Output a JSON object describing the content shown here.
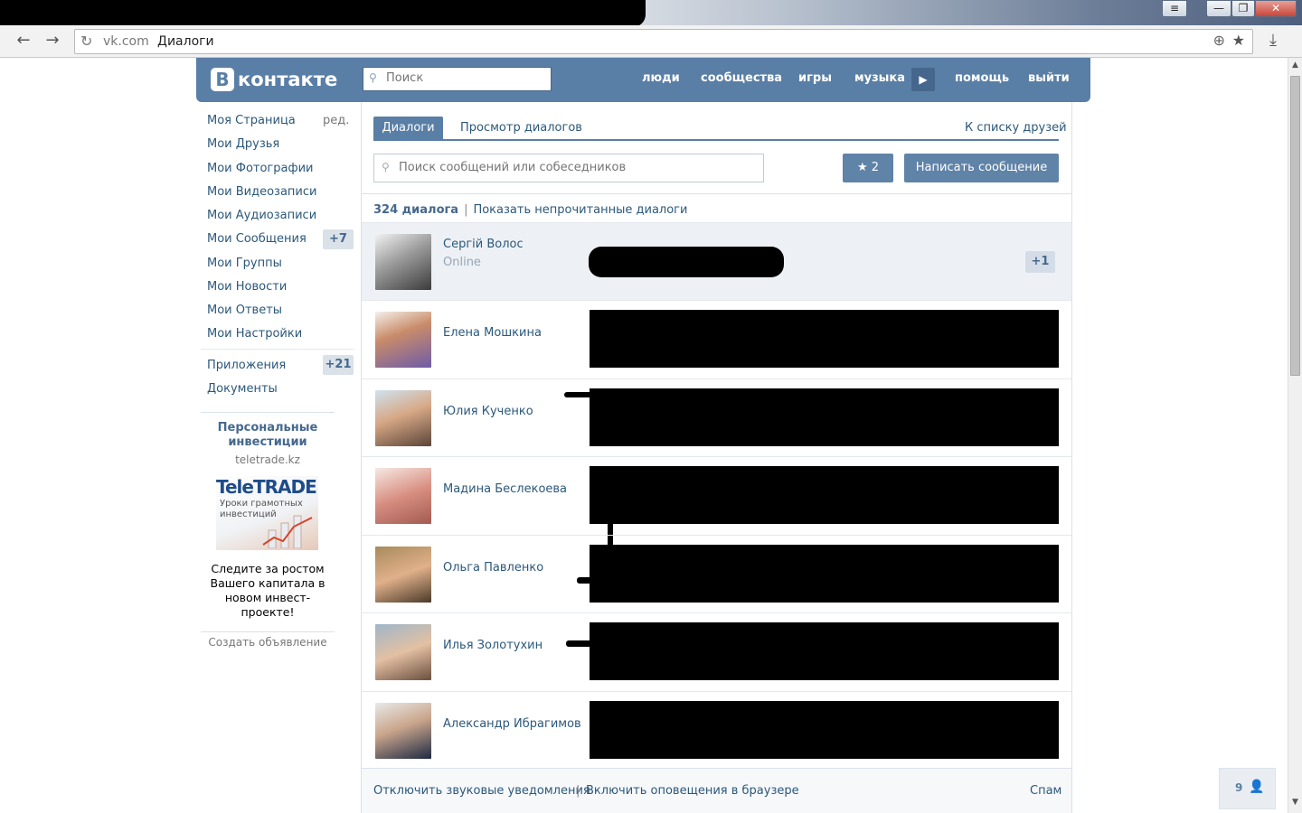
{
  "browser": {
    "url_host": "vk.com",
    "url_path": "Диалоги",
    "back_glyph": "←",
    "forward_glyph": "→",
    "reload_glyph": "↻",
    "zoom_glyph": "⊕",
    "star_glyph": "★",
    "download_glyph": "⤓",
    "window_buttons": [
      "≡",
      "—",
      "❐",
      "✕"
    ]
  },
  "header": {
    "logo_letter": "В",
    "logo_text": "контакте",
    "search_placeholder": "Поиск",
    "nav": [
      "люди",
      "сообщества",
      "игры",
      "музыка",
      "помощь",
      "выйти"
    ],
    "music_arrow": "▶"
  },
  "left_menu": {
    "items": [
      {
        "label": "Моя Страница"
      },
      {
        "label": "Мои Друзья"
      },
      {
        "label": "Мои Фотографии"
      },
      {
        "label": "Мои Видеозаписи"
      },
      {
        "label": "Мои Аудиозаписи"
      },
      {
        "label": "Мои Сообщения",
        "badge": "+7"
      },
      {
        "label": "Мои Группы"
      },
      {
        "label": "Мои Новости"
      },
      {
        "label": "Мои Ответы"
      },
      {
        "label": "Мои Настройки"
      }
    ],
    "edit_label": "ред.",
    "extra": [
      {
        "label": "Приложения",
        "badge": "+21"
      },
      {
        "label": "Документы"
      }
    ]
  },
  "ad": {
    "title": "Персональные инвестиции",
    "domain": "teletrade.kz",
    "brand": "TeleTRADE",
    "brand_sub": "Уроки грамотных инвестиций",
    "text": "Следите за ростом Вашего капитала в новом инвест-проекте!",
    "create_label": "Создать объявление"
  },
  "dialogs": {
    "tabs": [
      "Диалоги",
      "Просмотр диалогов"
    ],
    "to_friends": "К списку друзей",
    "search_placeholder": "Поиск сообщений или собеседников",
    "star_glyph": "★",
    "fav_count": "2",
    "write_label": "Написать сообщение",
    "count_label": "324 диалога",
    "separator": "|",
    "unread_link": "Показать непрочитанные диалоги",
    "rows": [
      {
        "name": "Сергій Волос",
        "status": "Online",
        "unread": "+1"
      },
      {
        "name": "Елена Мошкина"
      },
      {
        "name": "Юлия Кученко"
      },
      {
        "name": "Мадина Беслекоева"
      },
      {
        "name": "Ольга Павленко"
      },
      {
        "name": "Илья Золотухин"
      },
      {
        "name": "Александр Ибрагимов"
      }
    ],
    "mute_link": "Отключить звуковые уведомления",
    "notify_link": "Включить оповещения в браузере",
    "spam_link": "Спам"
  },
  "online_widget": {
    "count": "9",
    "icon": "👤"
  },
  "colors": {
    "brand": "#5a7fa6",
    "link": "#2b587a",
    "badge_bg": "#dae1e8"
  }
}
